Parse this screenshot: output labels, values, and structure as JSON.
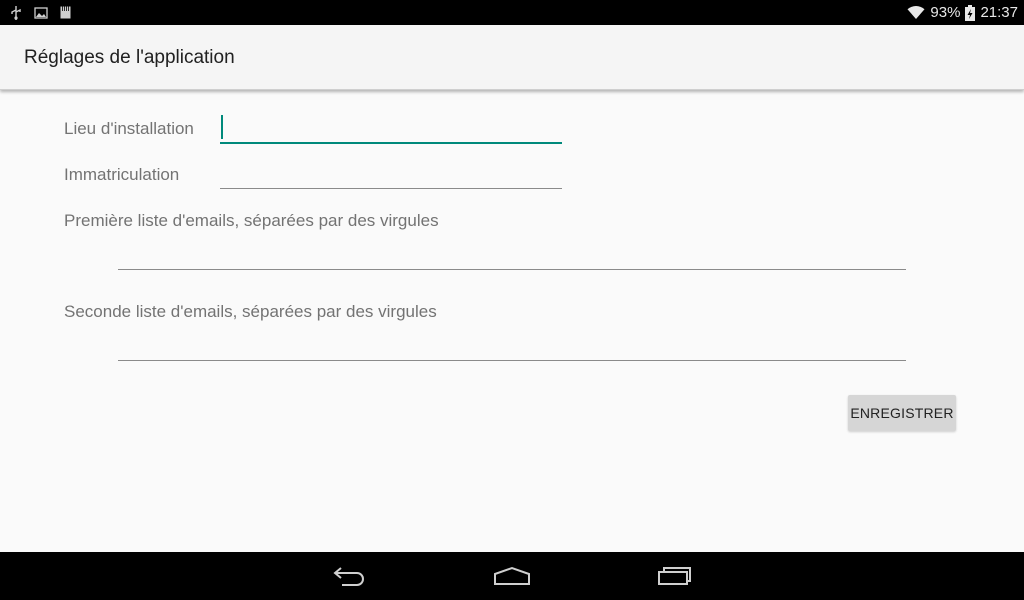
{
  "status_bar": {
    "icons_left": [
      "usb-icon",
      "image-icon",
      "sd-card-icon"
    ],
    "battery": "93%",
    "time": "21:37"
  },
  "app_bar": {
    "title": "Réglages de l'application"
  },
  "form": {
    "location_label": "Lieu d'installation",
    "location_value": "",
    "registration_label": "Immatriculation",
    "registration_value": "",
    "email_list_1_label": "Première liste d'emails, séparées par des virgules",
    "email_list_1_value": "",
    "email_list_2_label": "Seconde liste d'emails, séparées par des virgules",
    "email_list_2_value": "",
    "save_button": "ENREGISTRER"
  },
  "colors": {
    "accent": "#00897b",
    "status_bar": "#000000",
    "app_bar": "#f5f5f5",
    "background": "#fafafa",
    "button": "#d6d6d6"
  },
  "nav_bar": {
    "buttons": [
      "back-icon",
      "home-icon",
      "recent-apps-icon"
    ]
  }
}
